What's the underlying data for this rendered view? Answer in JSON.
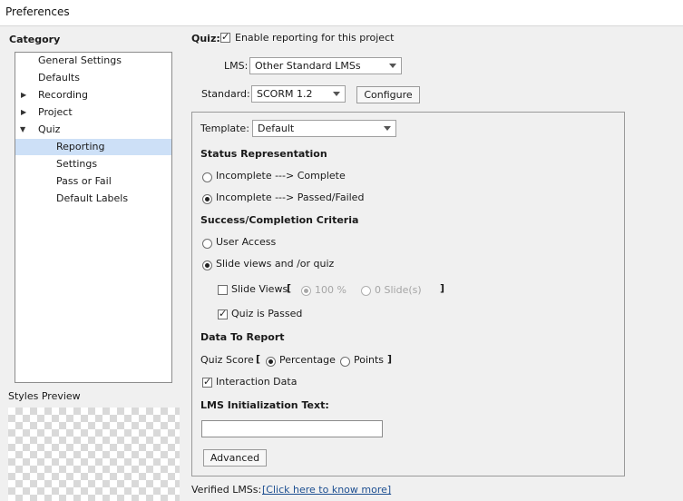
{
  "window": {
    "title": "Preferences"
  },
  "sidebar": {
    "heading": "Category",
    "items": [
      {
        "label": "General Settings"
      },
      {
        "label": "Defaults"
      },
      {
        "label": "Recording"
      },
      {
        "label": "Project"
      },
      {
        "label": "Quiz"
      },
      {
        "label": "Reporting"
      },
      {
        "label": "Settings"
      },
      {
        "label": "Pass or Fail"
      },
      {
        "label": "Default Labels"
      }
    ],
    "styles_preview_label": "Styles Preview"
  },
  "quiz": {
    "label": "Quiz:",
    "enable_reporting": {
      "label": "Enable reporting for this project",
      "checked": true
    },
    "lms": {
      "label": "LMS:",
      "value": "Other Standard LMSs"
    },
    "standard": {
      "label": "Standard:",
      "value": "SCORM 1.2"
    },
    "configure_button": "Configure"
  },
  "template": {
    "label": "Template:",
    "value": "Default"
  },
  "status_representation": {
    "heading": "Status Representation",
    "options": [
      {
        "label": "Incomplete ---> Complete",
        "selected": false
      },
      {
        "label": "Incomplete ---> Passed/Failed",
        "selected": true
      }
    ]
  },
  "criteria": {
    "heading": "Success/Completion Criteria",
    "user_access": {
      "label": "User Access",
      "selected": false
    },
    "slide_views_or_quiz": {
      "label": "Slide views and /or quiz",
      "selected": true
    },
    "slide_views": {
      "label": "Slide Views",
      "checked": false,
      "bracket_open": "[",
      "bracket_close": "]",
      "percent_option": "100 %",
      "slides_option": "0 Slide(s)"
    },
    "quiz_is_passed": {
      "label": "Quiz is Passed",
      "checked": true
    }
  },
  "data_to_report": {
    "heading": "Data To Report",
    "quiz_score_label": "Quiz Score",
    "bracket_open": "[",
    "bracket_close": "]",
    "percentage": {
      "label": "Percentage",
      "selected": true
    },
    "points": {
      "label": "Points",
      "selected": false
    },
    "interaction_data": {
      "label": "Interaction Data",
      "checked": true
    }
  },
  "lms_init": {
    "heading": "LMS Initialization Text:",
    "value": ""
  },
  "advanced_button": "Advanced",
  "verified": {
    "label": "Verified LMSs:",
    "link": "[Click here to know more]"
  }
}
